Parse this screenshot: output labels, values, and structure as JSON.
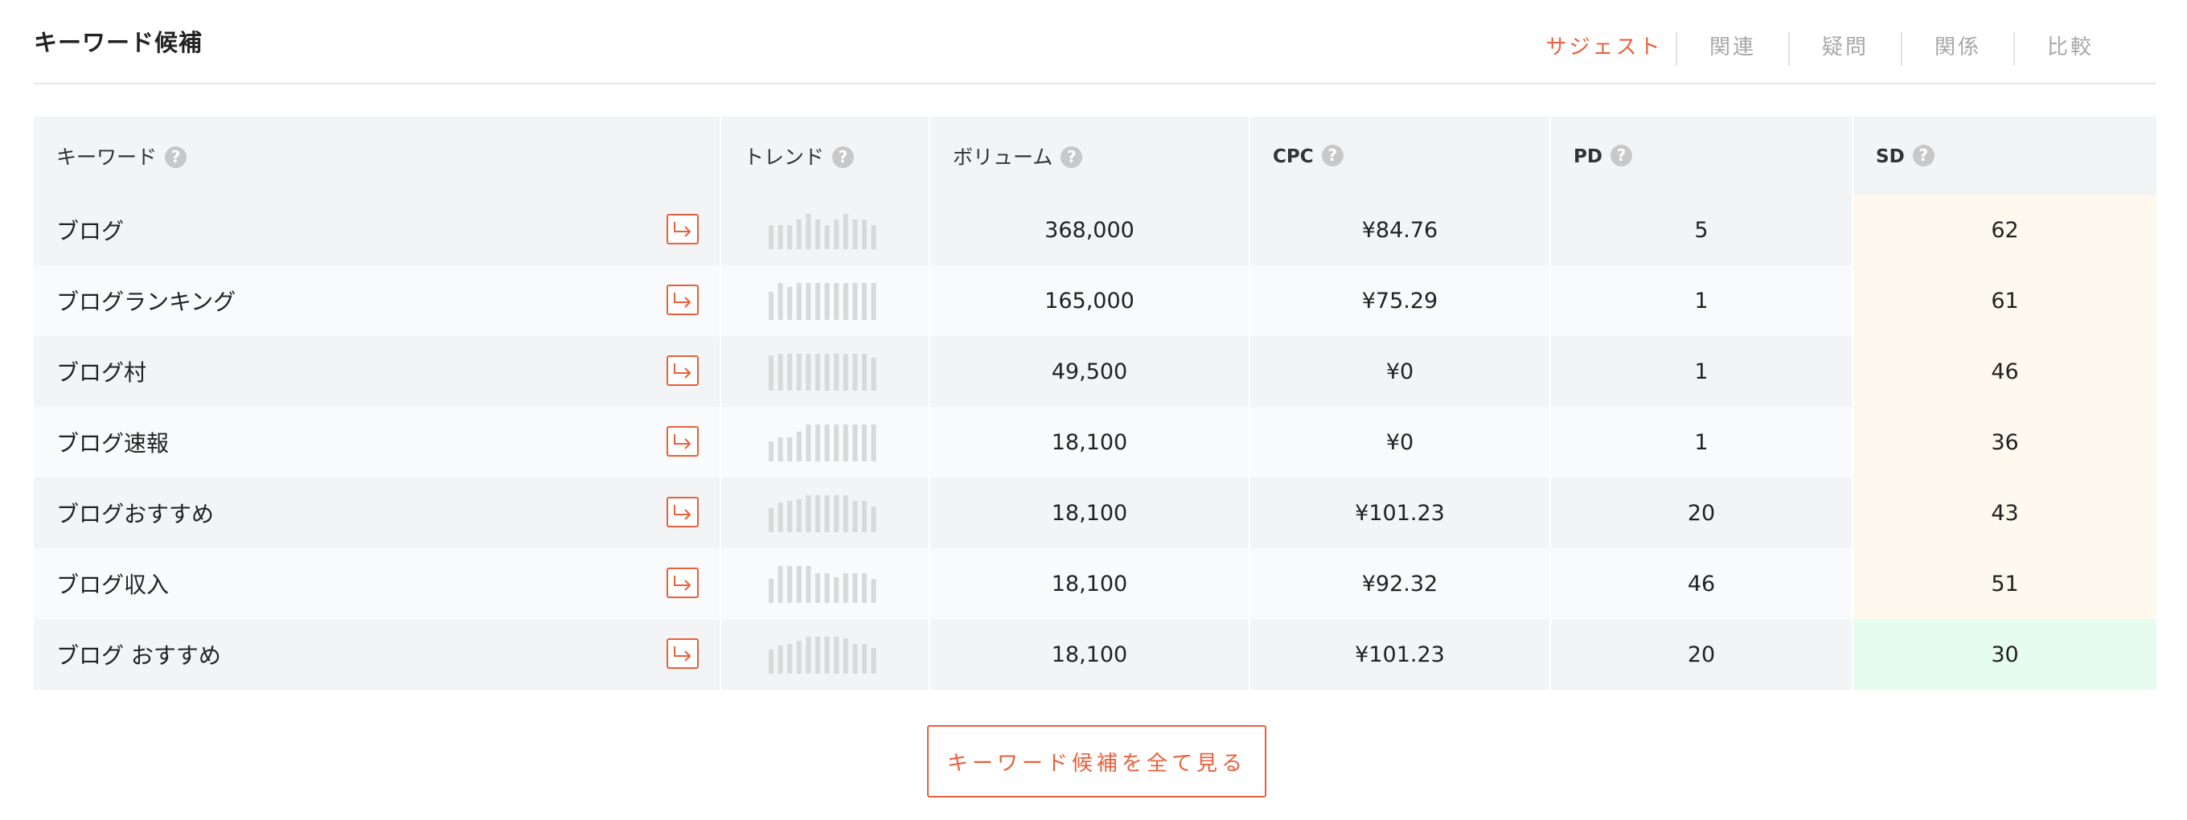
{
  "header": {
    "title": "キーワード候補",
    "tabs": [
      {
        "label": "サジェスト",
        "active": true
      },
      {
        "label": "関連",
        "active": false
      },
      {
        "label": "疑問",
        "active": false
      },
      {
        "label": "関係",
        "active": false
      },
      {
        "label": "比較",
        "active": false
      }
    ]
  },
  "table": {
    "columns": {
      "keyword": "キーワード",
      "trend": "トレンド",
      "volume": "ボリューム",
      "cpc": "CPC",
      "pd": "PD",
      "sd": "SD",
      "help_glyph": "?"
    },
    "rows": [
      {
        "keyword": "ブログ",
        "trend": [
          0.65,
          0.65,
          0.65,
          0.8,
          0.95,
          0.8,
          0.65,
          0.8,
          0.95,
          0.8,
          0.8,
          0.65
        ],
        "volume": "368,000",
        "cpc": "¥84.76",
        "pd": "5",
        "sd": "62"
      },
      {
        "keyword": "ブログランキング",
        "trend": [
          0.75,
          1.0,
          0.9,
          1.0,
          1.0,
          1.0,
          1.0,
          1.0,
          1.0,
          1.0,
          1.0,
          1.0
        ],
        "volume": "165,000",
        "cpc": "¥75.29",
        "pd": "1",
        "sd": "61"
      },
      {
        "keyword": "ブログ村",
        "trend": [
          0.95,
          1.0,
          1.0,
          1.0,
          1.0,
          1.0,
          1.0,
          1.0,
          1.0,
          1.0,
          1.0,
          0.9
        ],
        "volume": "49,500",
        "cpc": "¥0",
        "pd": "1",
        "sd": "46"
      },
      {
        "keyword": "ブログ速報",
        "trend": [
          0.55,
          0.65,
          0.65,
          0.8,
          1.0,
          1.0,
          1.0,
          1.0,
          1.0,
          1.0,
          1.0,
          1.0
        ],
        "volume": "18,100",
        "cpc": "¥0",
        "pd": "1",
        "sd": "36"
      },
      {
        "keyword": "ブログおすすめ",
        "trend": [
          0.65,
          0.8,
          0.85,
          0.9,
          1.0,
          1.0,
          1.0,
          1.0,
          1.0,
          0.85,
          0.85,
          0.7
        ],
        "volume": "18,100",
        "cpc": "¥101.23",
        "pd": "20",
        "sd": "43"
      },
      {
        "keyword": "ブログ収入",
        "trend": [
          0.65,
          1.0,
          1.0,
          1.0,
          1.0,
          0.8,
          0.8,
          0.7,
          0.8,
          0.8,
          0.8,
          0.65
        ],
        "volume": "18,100",
        "cpc": "¥92.32",
        "pd": "46",
        "sd": "51"
      },
      {
        "keyword": "ブログ おすすめ",
        "trend": [
          0.65,
          0.75,
          0.8,
          0.9,
          1.0,
          1.0,
          1.0,
          1.0,
          0.95,
          0.8,
          0.8,
          0.7
        ],
        "volume": "18,100",
        "cpc": "¥101.23",
        "pd": "20",
        "sd": "30"
      }
    ]
  },
  "view_all_label": "キーワード候補を全て見る",
  "colors": {
    "accent": "#e8603c",
    "trend_bar": "#d9d9d9",
    "sd_mid_bg": "#fef9ee",
    "sd_low_bg": "#e5fcee"
  },
  "icons": {
    "row_action": "arrow-turn-right-icon",
    "help": "question-circle-icon"
  }
}
